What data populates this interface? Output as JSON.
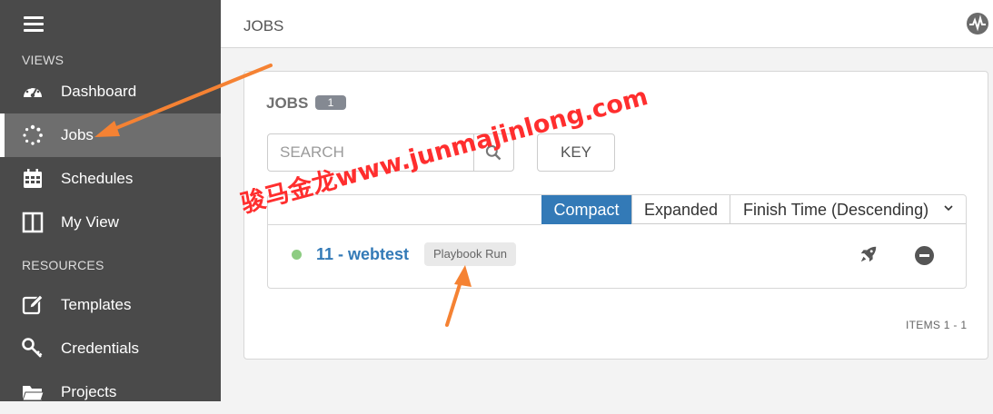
{
  "sidebar": {
    "sections": {
      "views": "VIEWS",
      "resources": "RESOURCES"
    },
    "items": [
      {
        "label": "Dashboard",
        "icon": "dashboard-icon"
      },
      {
        "label": "Jobs",
        "icon": "jobs-spinner-icon",
        "active": true
      },
      {
        "label": "Schedules",
        "icon": "calendar-icon"
      },
      {
        "label": "My View",
        "icon": "columns-icon"
      },
      {
        "label": "Templates",
        "icon": "edit-icon"
      },
      {
        "label": "Credentials",
        "icon": "key-icon"
      },
      {
        "label": "Projects",
        "icon": "folder-icon"
      }
    ]
  },
  "header": {
    "title": "JOBS",
    "activity_icon": "activity-stream-icon"
  },
  "panel": {
    "title": "JOBS",
    "count": "1",
    "search_placeholder": "SEARCH",
    "key_label": "KEY",
    "view_compact": "Compact",
    "view_expanded": "Expanded",
    "sort_label": "Finish Time (Descending)",
    "jobs": [
      {
        "name": "11 - webtest",
        "type": "Playbook Run",
        "status_color": "#8dcc82"
      }
    ],
    "items_label": "ITEMS  1 - 1"
  },
  "watermark": "骏马金龙www.junmajinlong.com",
  "colors": {
    "sidebar": "#4a4a4a",
    "accent": "#337ab7",
    "annotation": "#f58233"
  }
}
